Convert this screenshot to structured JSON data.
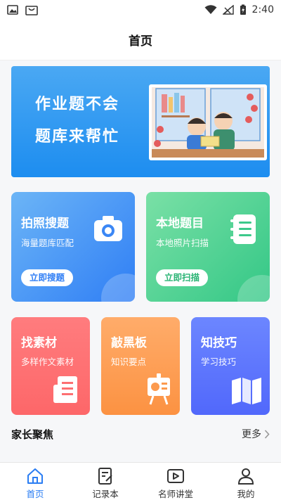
{
  "status": {
    "time": "2:40"
  },
  "header": {
    "title": "首页"
  },
  "banner": {
    "line1": "作业题不会",
    "line2": "题库来帮忙"
  },
  "cards": {
    "photo": {
      "title": "拍照搜题",
      "subtitle": "海量题库匹配",
      "button": "立即搜题",
      "color": "#2f7ef5"
    },
    "local": {
      "title": "本地题目",
      "subtitle": "本地照片扫描",
      "button": "立即扫描",
      "color": "#33c786"
    },
    "material": {
      "title": "找素材",
      "subtitle": "多样作文素材"
    },
    "board": {
      "title": "敲黑板",
      "subtitle": "知识要点"
    },
    "skill": {
      "title": "知技巧",
      "subtitle": "学习技巧"
    }
  },
  "focus": {
    "title": "家长聚焦",
    "more": "更多"
  },
  "tabs": [
    {
      "label": "首页",
      "icon": "home-icon",
      "active": true
    },
    {
      "label": "记录本",
      "icon": "notebook-icon",
      "active": false
    },
    {
      "label": "名师讲堂",
      "icon": "video-play-icon",
      "active": false
    },
    {
      "label": "我的",
      "icon": "user-icon",
      "active": false
    }
  ]
}
